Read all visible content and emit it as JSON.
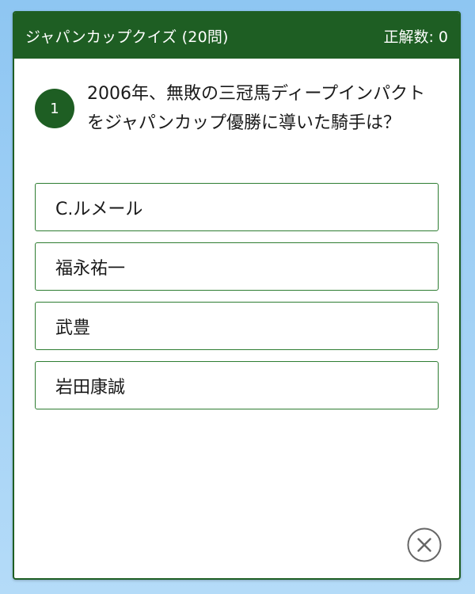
{
  "header": {
    "title": "ジャパンカップクイズ (20問)",
    "score": "正解数: 0"
  },
  "question": {
    "number": "1",
    "text": "2006年、無敗の三冠馬ディープインパクトをジャパンカップ優勝に導いた騎手は？"
  },
  "choices": [
    {
      "label": "C.ルメール"
    },
    {
      "label": "福永祐一"
    },
    {
      "label": "武豊"
    },
    {
      "label": "岩田康誠"
    }
  ],
  "icons": {
    "close": "close-icon"
  },
  "colors": {
    "accent": "#1e5e23",
    "border": "#2e7d32",
    "background": "#8ec6f2"
  }
}
